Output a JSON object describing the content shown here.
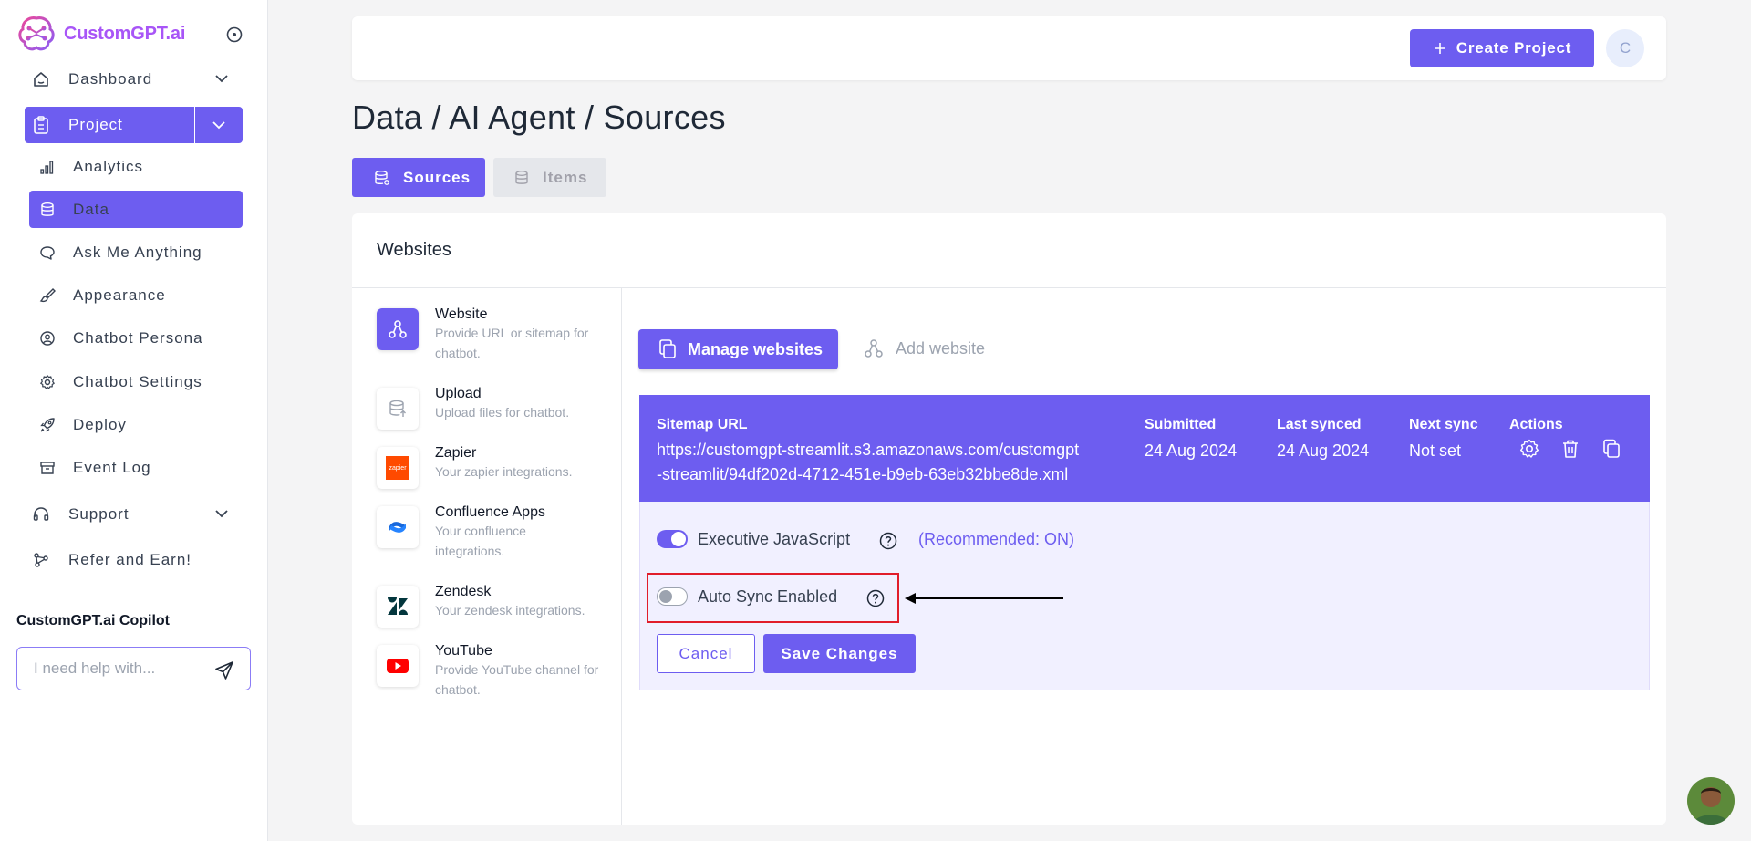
{
  "brand": {
    "name": "CustomGPT.ai",
    "accent": "#6d5df0",
    "logo_color": "#a855f7"
  },
  "sidebar": {
    "dashboard": "Dashboard",
    "project": "Project",
    "sub_items": [
      {
        "label": "Analytics",
        "icon": "bar-chart-icon"
      },
      {
        "label": "Data",
        "icon": "database-icon",
        "active": true
      },
      {
        "label": "Ask Me Anything",
        "icon": "chat-bubble-icon"
      },
      {
        "label": "Appearance",
        "icon": "brush-icon"
      },
      {
        "label": "Chatbot Persona",
        "icon": "user-circle-icon"
      },
      {
        "label": "Chatbot Settings",
        "icon": "gear-icon"
      },
      {
        "label": "Deploy",
        "icon": "rocket-icon"
      },
      {
        "label": "Event Log",
        "icon": "archive-icon"
      }
    ],
    "support": "Support",
    "refer": "Refer and Earn!",
    "copilot_title": "CustomGPT.ai Copilot",
    "copilot_placeholder": "I need help with..."
  },
  "header": {
    "create_project": "Create Project",
    "avatar_initial": "C"
  },
  "page": {
    "title": "Data / AI Agent / Sources",
    "tabs": [
      "Sources",
      "Items"
    ]
  },
  "card": {
    "title": "Websites",
    "sources": [
      {
        "name": "Website",
        "desc": "Provide URL or sitemap for chatbot."
      },
      {
        "name": "Upload",
        "desc": "Upload files for chatbot."
      },
      {
        "name": "Zapier",
        "desc": "Your zapier integrations."
      },
      {
        "name": "Confluence Apps",
        "desc": "Your confluence integrations."
      },
      {
        "name": "Zendesk",
        "desc": "Your zendesk integrations."
      },
      {
        "name": "YouTube",
        "desc": "Provide YouTube channel for chatbot."
      }
    ],
    "manage_websites": "Manage websites",
    "add_website": "Add website",
    "table": {
      "headers": {
        "url": "Sitemap URL",
        "submitted": "Submitted",
        "last_synced": "Last synced",
        "next_sync": "Next sync",
        "actions": "Actions"
      },
      "row": {
        "url_line1": "https://customgpt-streamlit.s3.amazonaws.com/customgpt",
        "url_line2": "-streamlit/94df202d-4712-451e-b9eb-63eb32bbe8de.xml",
        "submitted": "24 Aug 2024",
        "last_synced": "24 Aug 2024",
        "next_sync": "Not set"
      }
    },
    "options": {
      "exec_js": "Executive JavaScript",
      "exec_js_on": true,
      "recommended": "(Recommended: ON)",
      "auto_sync": "Auto Sync Enabled",
      "auto_sync_on": false
    },
    "cancel": "Cancel",
    "save": "Save Changes"
  },
  "zapier_badge": "zapier"
}
